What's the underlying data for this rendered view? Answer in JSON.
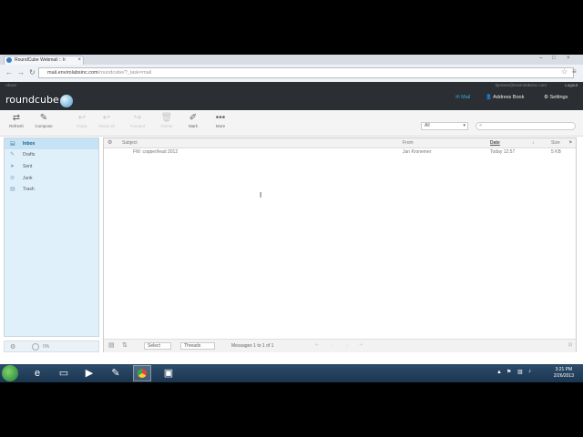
{
  "browser": {
    "tab_title": "RoundCube Webmail :: Ir",
    "url_host": "mail.envirolabsinc.com",
    "url_path": "/roundcube/?_task=mail",
    "bookmark": "About"
  },
  "header": {
    "logo": "roundcube",
    "user_email": "kjensen@envirolabsinc.com",
    "logout": "Logout",
    "nav": {
      "mail": "Mail",
      "address_book": "Address Book",
      "settings": "Settings"
    }
  },
  "toolbar": {
    "refresh": "Refresh",
    "compose": "Compose",
    "reply": "Reply",
    "reply_all": "Reply all",
    "forward": "Forward",
    "delete": "Delete",
    "mark": "Mark",
    "more": "More",
    "filter_value": "All"
  },
  "folders": [
    "Inbox",
    "Drafts",
    "Sent",
    "Junk",
    "Trash"
  ],
  "folder_footer": {
    "quota": "0%"
  },
  "list": {
    "columns": {
      "subject": "Subject",
      "from": "From",
      "date": "Date",
      "size": "Size"
    },
    "rows": [
      {
        "subject": "FW: copper/lead 2012",
        "from": "Jan Kronemer",
        "date": "Today 12:57",
        "size": "5 KB"
      }
    ],
    "footer": {
      "select": "Select",
      "threads": "Threads",
      "count": "Messages 1 to 1 of 1"
    }
  },
  "taskbar": {
    "time": "3:21 PM",
    "date": "2/26/2013"
  }
}
